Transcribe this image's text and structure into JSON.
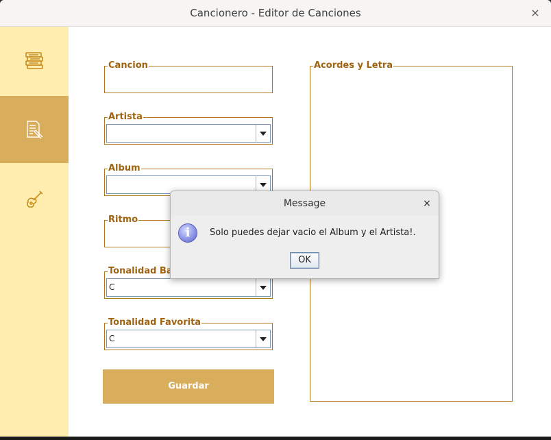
{
  "window": {
    "title": "Cancionero - Editor de Canciones",
    "close_glyph": "×"
  },
  "sidebar": {
    "items": [
      {
        "name": "songbook-stack-icon",
        "active": false
      },
      {
        "name": "song-editor-icon",
        "active": true
      },
      {
        "name": "guitar-icon",
        "active": false
      }
    ]
  },
  "form": {
    "cancion": {
      "label": "Cancion",
      "value": ""
    },
    "artista": {
      "label": "Artista",
      "value": ""
    },
    "album": {
      "label": "Album",
      "value": ""
    },
    "ritmo": {
      "label": "Ritmo",
      "value": ""
    },
    "tonalidad_base": {
      "label": "Tonalidad Base",
      "value": "C"
    },
    "tonalidad_favorita": {
      "label": "Tonalidad Favorita",
      "value": "C"
    },
    "acordes_letra": {
      "label": "Acordes y Letra",
      "value": ""
    },
    "save_label": "Guardar"
  },
  "dialog": {
    "title": "Message",
    "close_glyph": "×",
    "icon": "info-icon",
    "icon_glyph": "i",
    "message": "Solo puedes dejar vacio el Album y el Artista!.",
    "ok_label": "OK"
  },
  "colors": {
    "sidebar_bg": "#ffeeb0",
    "accent": "#d8ad5c",
    "label": "#a06410",
    "border": "#b0781a"
  }
}
